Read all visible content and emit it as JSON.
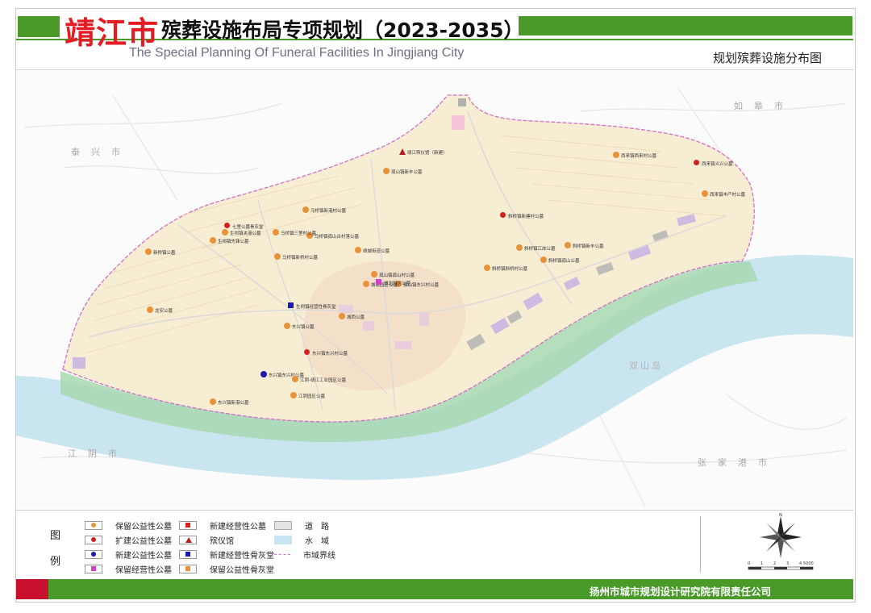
{
  "header": {
    "city": "靖江市",
    "title": "殡葬设施布局专项规划（2023-2035）",
    "title_en": "The Special Planning Of Funeral Facilities In Jingjiang City",
    "subtitle": "规划殡葬设施分布图"
  },
  "colors": {
    "brand_green": "#4a9a2a",
    "brand_red": "#c8102e",
    "title_red": "#e51c24",
    "water": "#c9e5f0",
    "land": "#f7edd3",
    "road": "#e3e3e3",
    "greenbelt": "#9fd3a8"
  },
  "map": {
    "neighbors": [
      {
        "name": "泰兴市"
      },
      {
        "name": "如皋市"
      },
      {
        "name": "江阴市"
      },
      {
        "name": "张家港市"
      },
      {
        "name": "双山岛"
      }
    ],
    "facilities": [
      {
        "type": "retained-public",
        "label": "孤山镇新丰公墓"
      },
      {
        "type": "funeral-home",
        "label": "靖江殡仪馆（新建）"
      },
      {
        "type": "retained-public",
        "label": "马桥镇新港村公墓"
      },
      {
        "type": "retained-public",
        "label": "马桥镇孤山古村落公墓"
      },
      {
        "type": "expand-public",
        "label": "七里公墓骨灰堂"
      },
      {
        "type": "retained-public",
        "label": "生祠镇先锋公墓"
      },
      {
        "type": "retained-public",
        "label": "生祠镇夹港公墓"
      },
      {
        "type": "retained-public",
        "label": "马桥镇三里村公墓"
      },
      {
        "type": "retained-public",
        "label": "马桥镇新桥村公墓"
      },
      {
        "type": "retained-public",
        "label": "靖城街道公墓"
      },
      {
        "type": "retained-public",
        "label": "孤山镇孤山村公墓"
      },
      {
        "type": "retained-public",
        "label": "孤山镇东兴村公墓"
      },
      {
        "type": "expand-public",
        "label": "斜桥镇新建村公墓"
      },
      {
        "type": "retained-public",
        "label": "斜桥镇江岸公墓"
      },
      {
        "type": "retained-public",
        "label": "西来镇西来村公墓"
      },
      {
        "type": "expand-public",
        "label": "西来镇义兴公墓"
      },
      {
        "type": "retained-public",
        "label": "西来镇丰产村公墓"
      },
      {
        "type": "retained-public",
        "label": "斜桥镇新丰公墓"
      },
      {
        "type": "retained-public",
        "label": "新桥镇公墓"
      },
      {
        "type": "retained-public",
        "label": "龙安公墓"
      },
      {
        "type": "new-operating-ash",
        "label": "生祠镇经营性骨灰堂"
      },
      {
        "type": "retained-public",
        "label": "东兴镇公墓"
      },
      {
        "type": "expand-public",
        "label": "东兴镇东兴村公墓"
      },
      {
        "type": "new-public",
        "label": "东兴镇东兴村公墓"
      },
      {
        "type": "retained-public",
        "label": "江阴-靖江工业园区公墓"
      },
      {
        "type": "retained-public",
        "label": "江阴园区公墓"
      },
      {
        "type": "retained-public",
        "label": "东兴镇新港公墓"
      },
      {
        "type": "retained-public",
        "label": "城南园区公墓"
      },
      {
        "type": "retained-public",
        "label": "城西公墓"
      },
      {
        "type": "retained-operating",
        "label": "城北园区公墓"
      },
      {
        "type": "retained-public",
        "label": "斜桥镇斜桥村公墓"
      },
      {
        "type": "retained-public",
        "label": "斜桥镇孤山公墓"
      }
    ]
  },
  "legend": {
    "title": "图例",
    "items": [
      {
        "label": "保留公益性公墓",
        "kind": "retained-public"
      },
      {
        "label": "扩建公益性公墓",
        "kind": "expand-public"
      },
      {
        "label": "新建公益性公墓",
        "kind": "new-public"
      },
      {
        "label": "保留经营性公墓",
        "kind": "retained-operating"
      },
      {
        "label": "新建经营性公墓",
        "kind": "new-operating"
      },
      {
        "label": "殡仪馆",
        "kind": "funeral-home"
      },
      {
        "label": "新建经营性骨灰堂",
        "kind": "new-operating-ash"
      },
      {
        "label": "保留公益性骨灰堂",
        "kind": "retained-public-ash"
      },
      {
        "label": "道　路",
        "kind": "road"
      },
      {
        "label": "水　域",
        "kind": "water"
      },
      {
        "label": "市域界线",
        "kind": "boundary"
      }
    ],
    "scale_labels": [
      "0",
      "1",
      "2",
      "3",
      "4",
      "5000"
    ],
    "compass_n": "N"
  },
  "footer": {
    "org": "扬州市城市规划设计研究院有限责任公司"
  }
}
